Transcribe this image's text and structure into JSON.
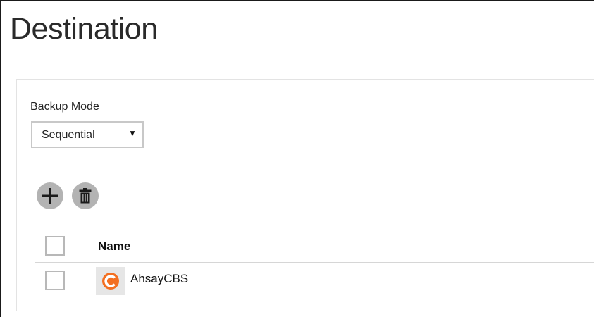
{
  "page": {
    "title": "Destination"
  },
  "backup_mode": {
    "label": "Backup Mode",
    "selected": "Sequential"
  },
  "toolbar": {
    "add_icon": "plus-icon",
    "delete_icon": "trash-icon"
  },
  "table": {
    "columns": [
      "Name"
    ],
    "rows": [
      {
        "name": "AhsayCBS",
        "icon": "ahsay-logo-icon",
        "checked": false
      }
    ]
  },
  "colors": {
    "button_bg": "#b3b3b3",
    "brand_orange": "#f36f21"
  }
}
